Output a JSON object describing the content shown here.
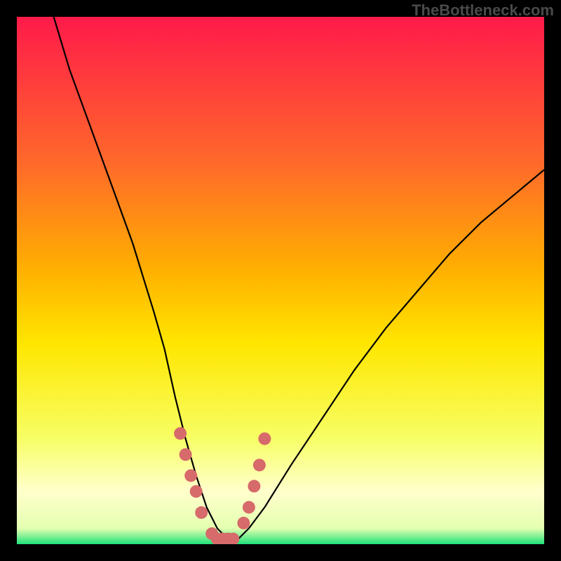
{
  "watermark": "TheBottleneck.com",
  "colors": {
    "frame_bg": "#000000",
    "gradient_top": "#ff1a4a",
    "gradient_mid1": "#ff6a2a",
    "gradient_mid2": "#ffb000",
    "gradient_mid3": "#ffe600",
    "gradient_low": "#f7ff66",
    "gradient_band": "#ffffcc",
    "gradient_bottom": "#1fe27a",
    "curve": "#000000",
    "marker": "#d76a6a"
  },
  "chart_data": {
    "type": "line",
    "title": "",
    "xlabel": "",
    "ylabel": "",
    "xlim": [
      0,
      100
    ],
    "ylim": [
      0,
      100
    ],
    "series": [
      {
        "name": "bottleneck-curve",
        "x": [
          7,
          10,
          14,
          18,
          22,
          26,
          28,
          30,
          32,
          34,
          36,
          38,
          40,
          42,
          44,
          47,
          52,
          58,
          64,
          70,
          76,
          82,
          88,
          94,
          100
        ],
        "y": [
          100,
          90,
          79,
          68,
          57,
          44,
          37,
          28,
          20,
          13,
          7,
          3,
          1,
          1,
          3,
          7,
          15,
          24,
          33,
          41,
          48,
          55,
          61,
          66,
          71
        ]
      }
    ],
    "markers": {
      "name": "highlight-band",
      "x": [
        31,
        32,
        33,
        34,
        35,
        37,
        38,
        39,
        40,
        41,
        43,
        44,
        45,
        46,
        47
      ],
      "y": [
        21,
        17,
        13,
        10,
        6,
        2,
        1,
        1,
        1,
        1,
        4,
        7,
        11,
        15,
        20
      ]
    }
  }
}
